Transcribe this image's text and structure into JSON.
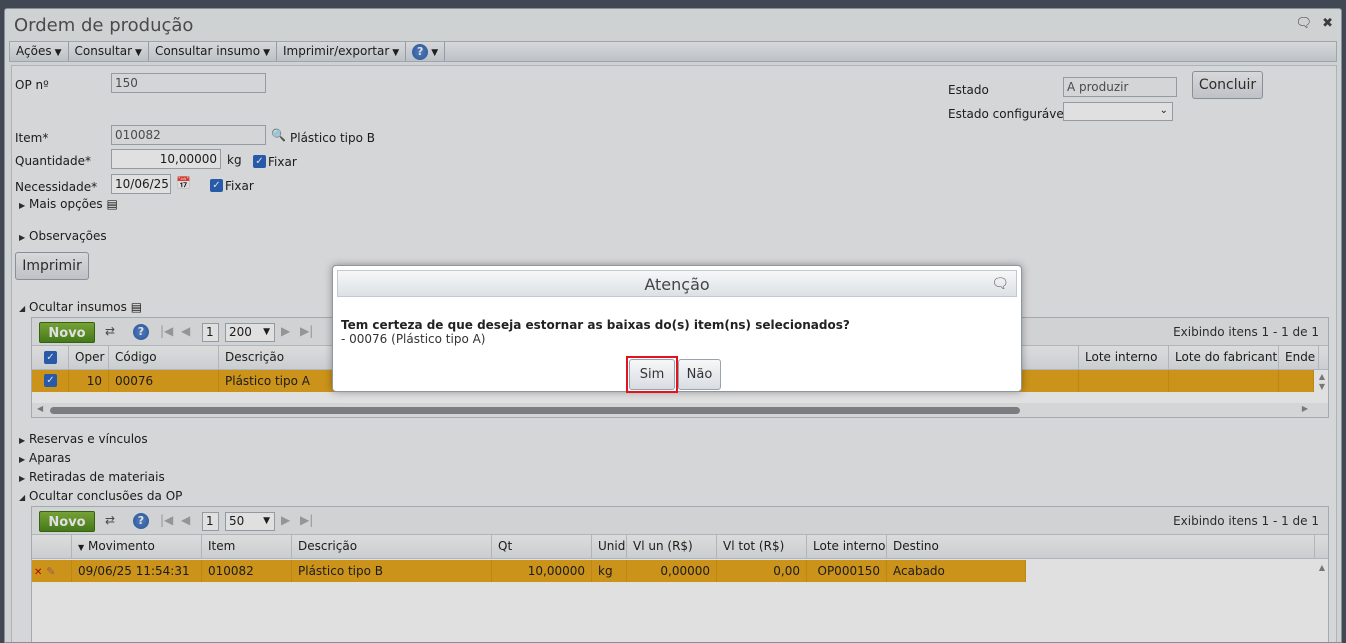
{
  "window": {
    "title": "Ordem de produção"
  },
  "menu": {
    "items": [
      "Ações",
      "Consultar",
      "Consultar insumo",
      "Imprimir/exportar"
    ],
    "help_label": "?"
  },
  "form": {
    "op_label": "OP nº",
    "op_value": "150",
    "item_label": "Item*",
    "item_value": "010082",
    "item_desc": "Plástico tipo B",
    "qty_label": "Quantidade*",
    "qty_value": "10,00000",
    "qty_unit": "kg",
    "fixar1": "Fixar",
    "need_label": "Necessidade*",
    "need_value": "10/06/25",
    "fixar2": "Fixar",
    "mais_opcoes": "Mais opções",
    "observacoes": "Observações",
    "imprimir": "Imprimir",
    "estado_label": "Estado",
    "estado_value": "A produzir",
    "estado_conf_label": "Estado configurável",
    "estado_conf_value": "",
    "concluir": "Concluir"
  },
  "insumos": {
    "section_label": "Ocultar insumos",
    "novo": "Novo",
    "page": "1",
    "page_size": "200",
    "showing": "Exibindo itens 1 - 1 de 1",
    "columns": [
      "Oper",
      "Código",
      "Descrição",
      "Lote interno",
      "Lote do fabricante",
      "Ende"
    ],
    "row": {
      "oper": "10",
      "codigo": "00076",
      "descricao": "Plástico tipo A"
    }
  },
  "sections": {
    "reservas": "Reservas e vínculos",
    "aparas": "Aparas",
    "retiradas": "Retiradas de materiais",
    "conclusoes": "Ocultar conclusões da OP"
  },
  "conclusoes": {
    "novo": "Novo",
    "page": "1",
    "page_size": "50",
    "showing": "Exibindo itens 1 - 1 de 1",
    "columns": [
      "Movimento",
      "Item",
      "Descrição",
      "Qt",
      "Unid",
      "Vl un (R$)",
      "Vl tot (R$)",
      "Lote interno",
      "Destino"
    ],
    "row": {
      "movimento": "09/06/25 11:54:31",
      "item": "010082",
      "descricao": "Plástico tipo B",
      "qt": "10,00000",
      "unid": "kg",
      "vl_un": "0,00000",
      "vl_tot": "0,00",
      "lote": "OP000150",
      "destino": "Acabado"
    }
  },
  "dialog": {
    "title": "Atenção",
    "question": "Tem certeza de que deseja estornar as baixas do(s) item(ns) selecionados?",
    "detail": "- 00076 (Plástico tipo A)",
    "yes": "Sim",
    "no": "Não"
  }
}
